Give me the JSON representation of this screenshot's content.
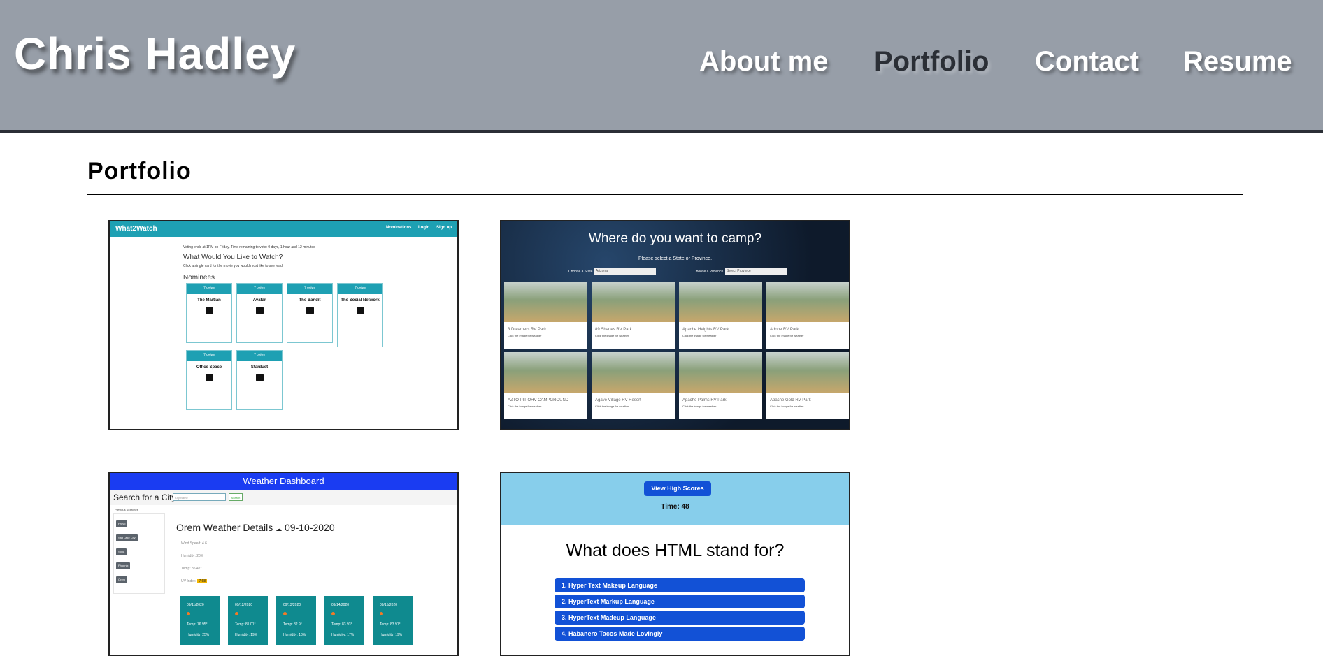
{
  "header": {
    "brand": "Chris Hadley",
    "nav": [
      "About me",
      "Portfolio",
      "Contact",
      "Resume"
    ]
  },
  "section": {
    "title": "Portfolio"
  },
  "cards": {
    "what2watch": {
      "brand": "What2Watch",
      "links": [
        "Nominations",
        "Login",
        "Sign up"
      ],
      "voting_note": "Voting ends at 1PM on Friday. Time remaining to vote: 0 days, 1 hour and 12 minutes",
      "heading": "What Would You Like to Watch?",
      "instruction": "Click a single card for the movie you would most like to see lead",
      "nominees_label": "Nominees",
      "nominees": [
        {
          "votes": "7 votes",
          "title": "The Martian"
        },
        {
          "votes": "7 votes",
          "title": "Avatar"
        },
        {
          "votes": "7 votes",
          "title": "The Bandit"
        },
        {
          "votes": "7 votes",
          "title": "The Social Network"
        },
        {
          "votes": "7 votes",
          "title": "Office Space"
        },
        {
          "votes": "7 votes",
          "title": "Stardust"
        }
      ]
    },
    "camp": {
      "title": "Where do you want to camp?",
      "subtitle": "Please select a State or Province.",
      "state_label": "Choose a State",
      "state_value": "Arizona",
      "province_label": "Choose a Province",
      "province_value": "Select Province",
      "parks": [
        "3 Dreamers RV Park",
        "89 Shades RV Park",
        "Apache Heights RV Park",
        "Adobe RV Park",
        "AZTO PIT OHV CAMPGROUND",
        "Agave Village RV Resort",
        "Apache Palms RV Park",
        "Apache Gold RV Park"
      ],
      "park_note": "Click the image for weather"
    },
    "weather": {
      "title": "Weather Dashboard",
      "search_label": "Search for a City:",
      "search_placeholder": "City Name",
      "search_button": "Search",
      "previous_label": "Previous Searches",
      "cities": [
        "Provo",
        "Salt Lake City",
        "Sofia",
        "Phoenix",
        "Orem"
      ],
      "details_heading": "Orem Weather Details",
      "date": "09-10-2020",
      "wind": "Wind Speed: 4.6",
      "humidity": "Humidity: 20%",
      "temp": "Temp: 85.47°",
      "uv_label": "UV Index:",
      "uv_value": "7.68",
      "forecast": [
        {
          "date": "09/11/2020",
          "temp": "Temp: 76.95°",
          "humidity": "Humidity: 25%"
        },
        {
          "date": "09/12/2020",
          "temp": "Temp: 81.01°",
          "humidity": "Humidity: 19%"
        },
        {
          "date": "09/13/2020",
          "temp": "Temp: 82.9°",
          "humidity": "Humidity: 18%"
        },
        {
          "date": "09/14/2020",
          "temp": "Temp: 83.93°",
          "humidity": "Humidity: 17%"
        },
        {
          "date": "09/15/2020",
          "temp": "Temp: 83.91°",
          "humidity": "Humidity: 19%"
        }
      ]
    },
    "quiz": {
      "button": "View High Scores",
      "time": "Time: 48",
      "question": "What does HTML stand for?",
      "options": [
        "1. Hyper Text Makeup Language",
        "2. HyperText Markup Language",
        "3. HyperText Madeup Language",
        "4. Habanero Tacos Made Lovingly"
      ]
    }
  },
  "colors": {
    "header_bg": "#979ea8",
    "accent_teal": "#1ea0b3",
    "weather_blue": "#1a3cf2",
    "quiz_blue": "#1251d6",
    "quiz_sky": "#87ceeb"
  }
}
